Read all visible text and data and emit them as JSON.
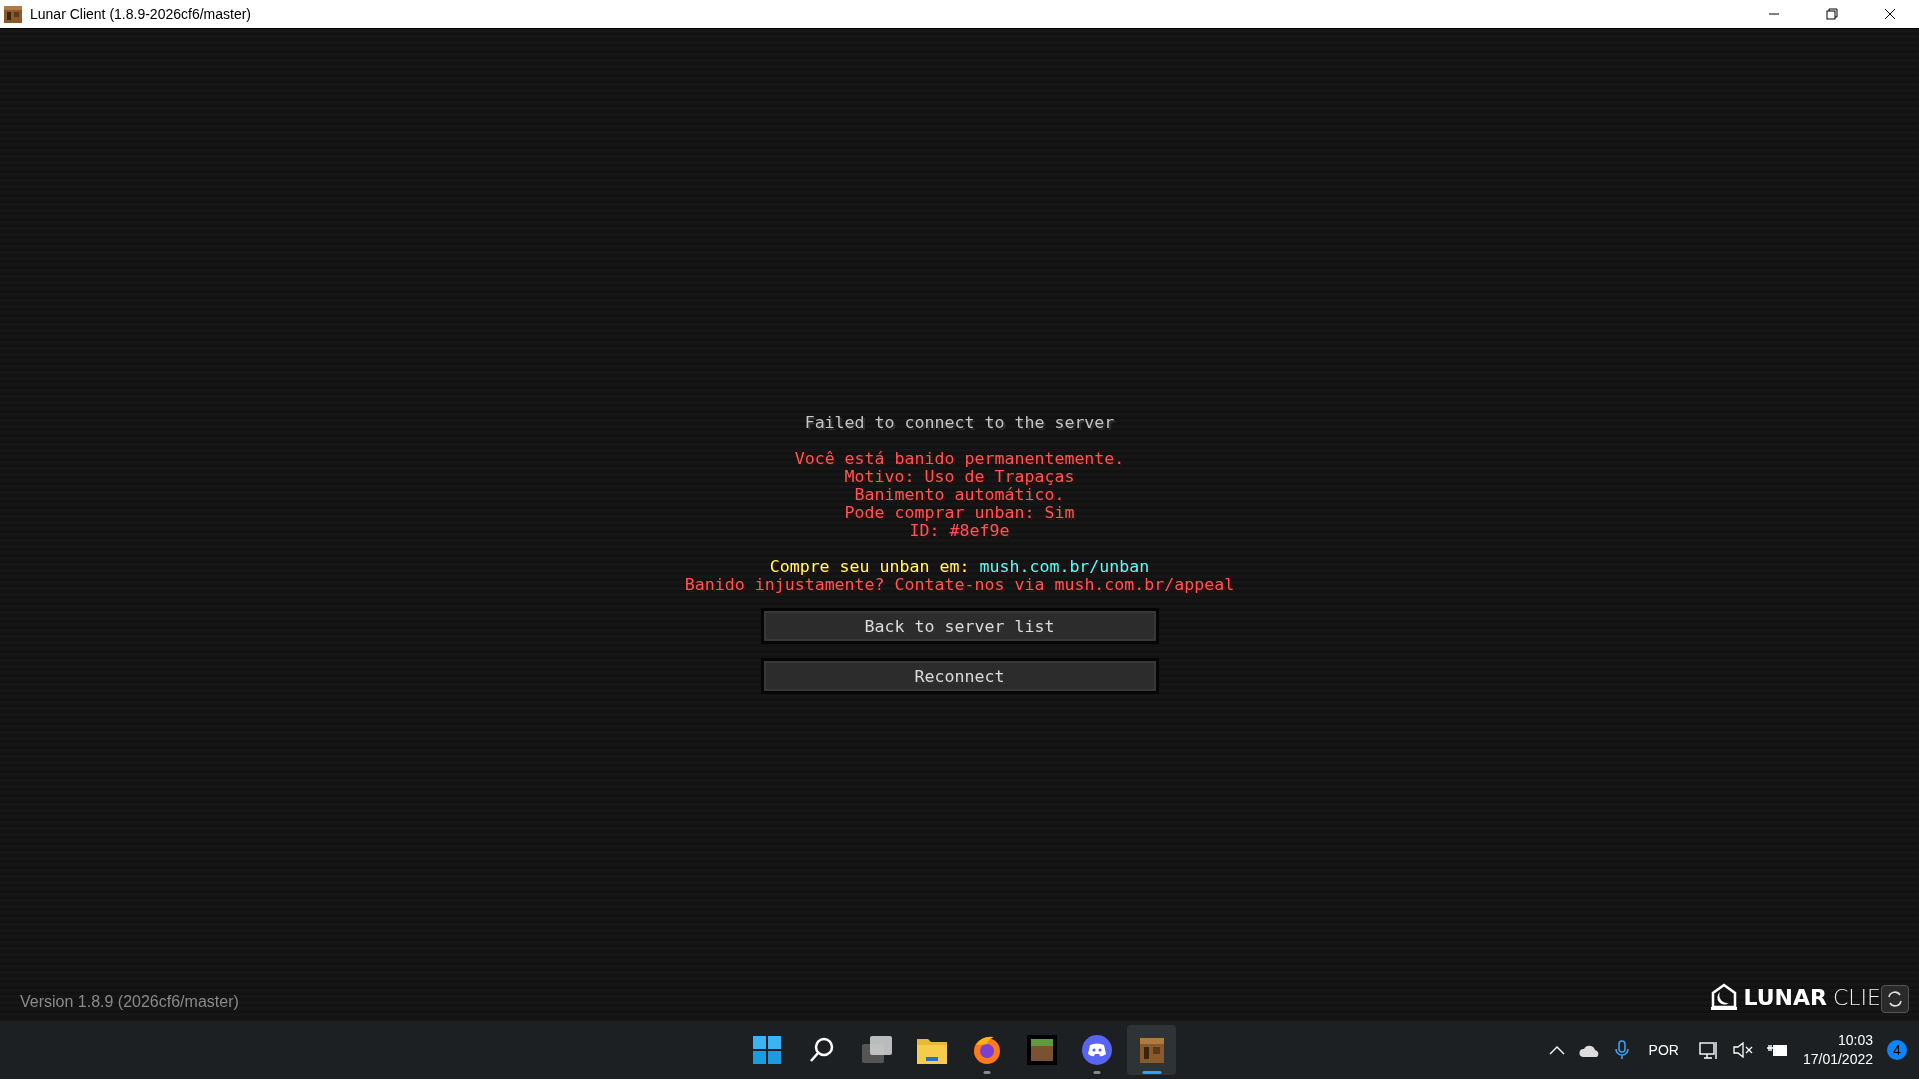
{
  "window": {
    "title": "Lunar Client (1.8.9-2026cf6/master)"
  },
  "screen": {
    "heading": "Failed to connect to the server",
    "message_groups": [
      [
        [
          {
            "text": "Você está banido permanentemente.",
            "color": "#ff5555"
          }
        ],
        [
          {
            "text": "Motivo: Uso de Trapaças",
            "color": "#ff5555"
          }
        ],
        [
          {
            "text": "Banimento automático.",
            "color": "#ff5555"
          }
        ],
        [
          {
            "text": "Pode comprar unban: Sim",
            "color": "#ff5555"
          }
        ],
        [
          {
            "text": "ID: #8ef9e",
            "color": "#ff5555"
          }
        ]
      ],
      [
        [
          {
            "text": "Compre seu unban em: ",
            "color": "#ffff55"
          },
          {
            "text": "mush.com.br/unban",
            "color": "#55ffff"
          }
        ],
        [
          {
            "text": "Banido injustamente? Contate-nos via mush.com.br/appeal",
            "color": "#ff5555"
          }
        ]
      ]
    ],
    "buttons": [
      "Back to server list",
      "Reconnect"
    ],
    "version": "Version 1.8.9 (2026cf6/master)",
    "logo": {
      "bold": "LUNAR",
      "light": "CLIE"
    }
  },
  "taskbar": {
    "apps": [
      {
        "kind": "start",
        "open": false,
        "selected": false
      },
      {
        "kind": "search",
        "open": false,
        "selected": false
      },
      {
        "kind": "taskview",
        "open": false,
        "selected": false
      },
      {
        "kind": "explorer",
        "open": false,
        "selected": false
      },
      {
        "kind": "browser",
        "open": true,
        "selected": false
      },
      {
        "kind": "grass",
        "open": false,
        "selected": false
      },
      {
        "kind": "chat",
        "open": true,
        "selected": false
      },
      {
        "kind": "crate",
        "open": true,
        "selected": true
      }
    ],
    "language": "POR",
    "time": "10:03",
    "date": "17/01/2022",
    "notifications": "4"
  }
}
